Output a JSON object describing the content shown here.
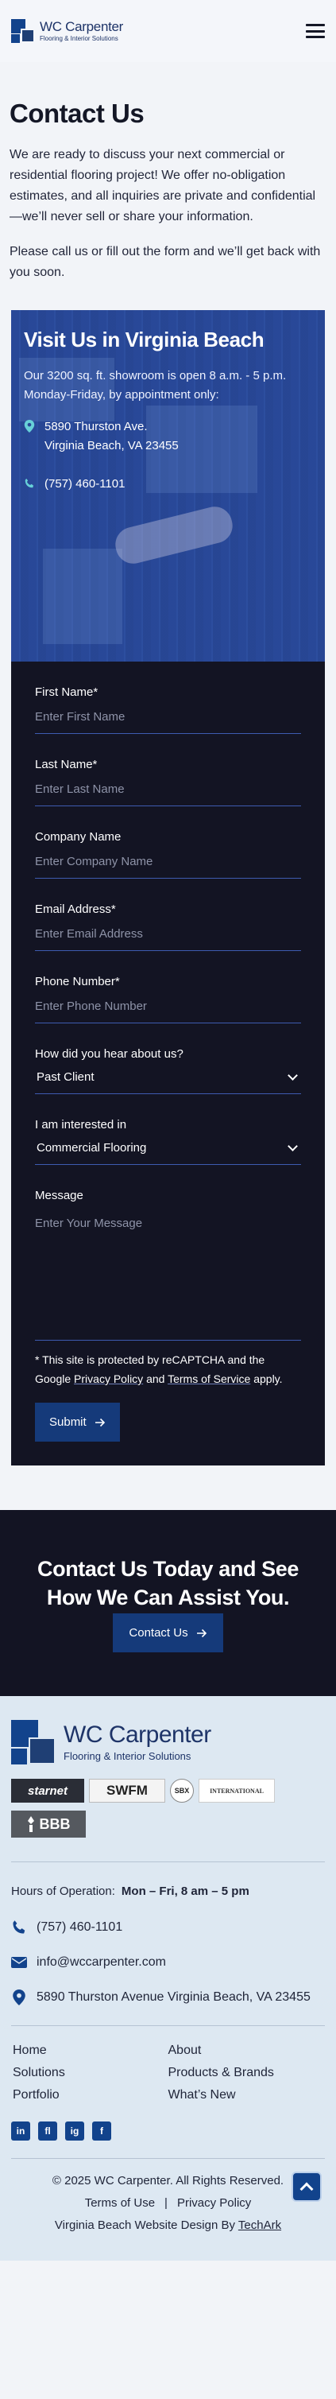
{
  "header": {
    "brand_name": "WC Carpenter",
    "brand_tagline": "Flooring & Interior Solutions"
  },
  "intro": {
    "title": "Contact Us",
    "paragraph1": "We are ready to discuss your next commercial or residential flooring project! We offer no-obligation estimates, and all inquiries are private and confidential—we’ll never sell or share your information.",
    "paragraph2": "Please call us or fill out the form and we’ll get back with you soon."
  },
  "visit": {
    "title": "Visit Us in Virginia Beach",
    "description": "Our 3200 sq. ft. showroom is open 8 a.m. - 5 p.m. Monday-Friday, by appointment only:",
    "address_line1": "5890 Thurston Ave.",
    "address_line2": "Virginia Beach, VA 23455",
    "phone": "(757) 460-1101"
  },
  "form": {
    "first_name_label": "First Name*",
    "first_name_placeholder": "Enter First Name",
    "last_name_label": "Last Name*",
    "last_name_placeholder": "Enter Last Name",
    "company_label": "Company Name",
    "company_placeholder": "Enter Company Name",
    "email_label": "Email Address*",
    "email_placeholder": "Enter Email Address",
    "phone_label": "Phone Number*",
    "phone_placeholder": "Enter Phone Number",
    "hear_label": "How did you hear about us?",
    "hear_value": "Past Client",
    "interest_label": "I am interested in",
    "interest_value": "Commercial Flooring",
    "message_label": "Message",
    "message_placeholder": "Enter Your Message",
    "captcha_prefix": "* This site is protected by reCAPTCHA and the Google ",
    "privacy_link": "Privacy Policy",
    "captcha_and": " and ",
    "terms_link": "Terms of Service",
    "captcha_suffix": " apply.",
    "submit_label": "Submit"
  },
  "cta": {
    "title": "Contact Us Today and See How We Can Assist You.",
    "button_label": "Contact Us"
  },
  "footer": {
    "brand_name": "WC Carpenter",
    "brand_tagline": "Flooring & Interior Solutions",
    "badges": {
      "starnet": "starnet",
      "swfm": "SWFM",
      "sbx": "SBX",
      "international": "INTERNATIONAL",
      "bbb": "BBB"
    },
    "hours_label": "Hours of Operation:",
    "hours_value": "Mon – Fri, 8 am – 5 pm",
    "phone": "(757) 460-1101",
    "email": "info@wccarpenter.com",
    "address": "5890 Thurston Avenue Virginia Beach, VA 23455",
    "nav": [
      "Home",
      "About",
      "Solutions",
      "Products & Brands",
      "Portfolio",
      "What’s New"
    ],
    "social": [
      "in",
      "fl",
      "ig",
      "f"
    ],
    "copyright": "© 2025 WC Carpenter. All Rights Reserved.",
    "terms": "Terms of Use",
    "separator": "|",
    "privacy": "Privacy Policy",
    "credit_prefix": "Virginia Beach Website Design By ",
    "credit_link": "TechArk"
  },
  "colors": {
    "brand_blue": "#12438c",
    "dark_navy": "#131423",
    "footer_bg": "#dde8f2"
  }
}
